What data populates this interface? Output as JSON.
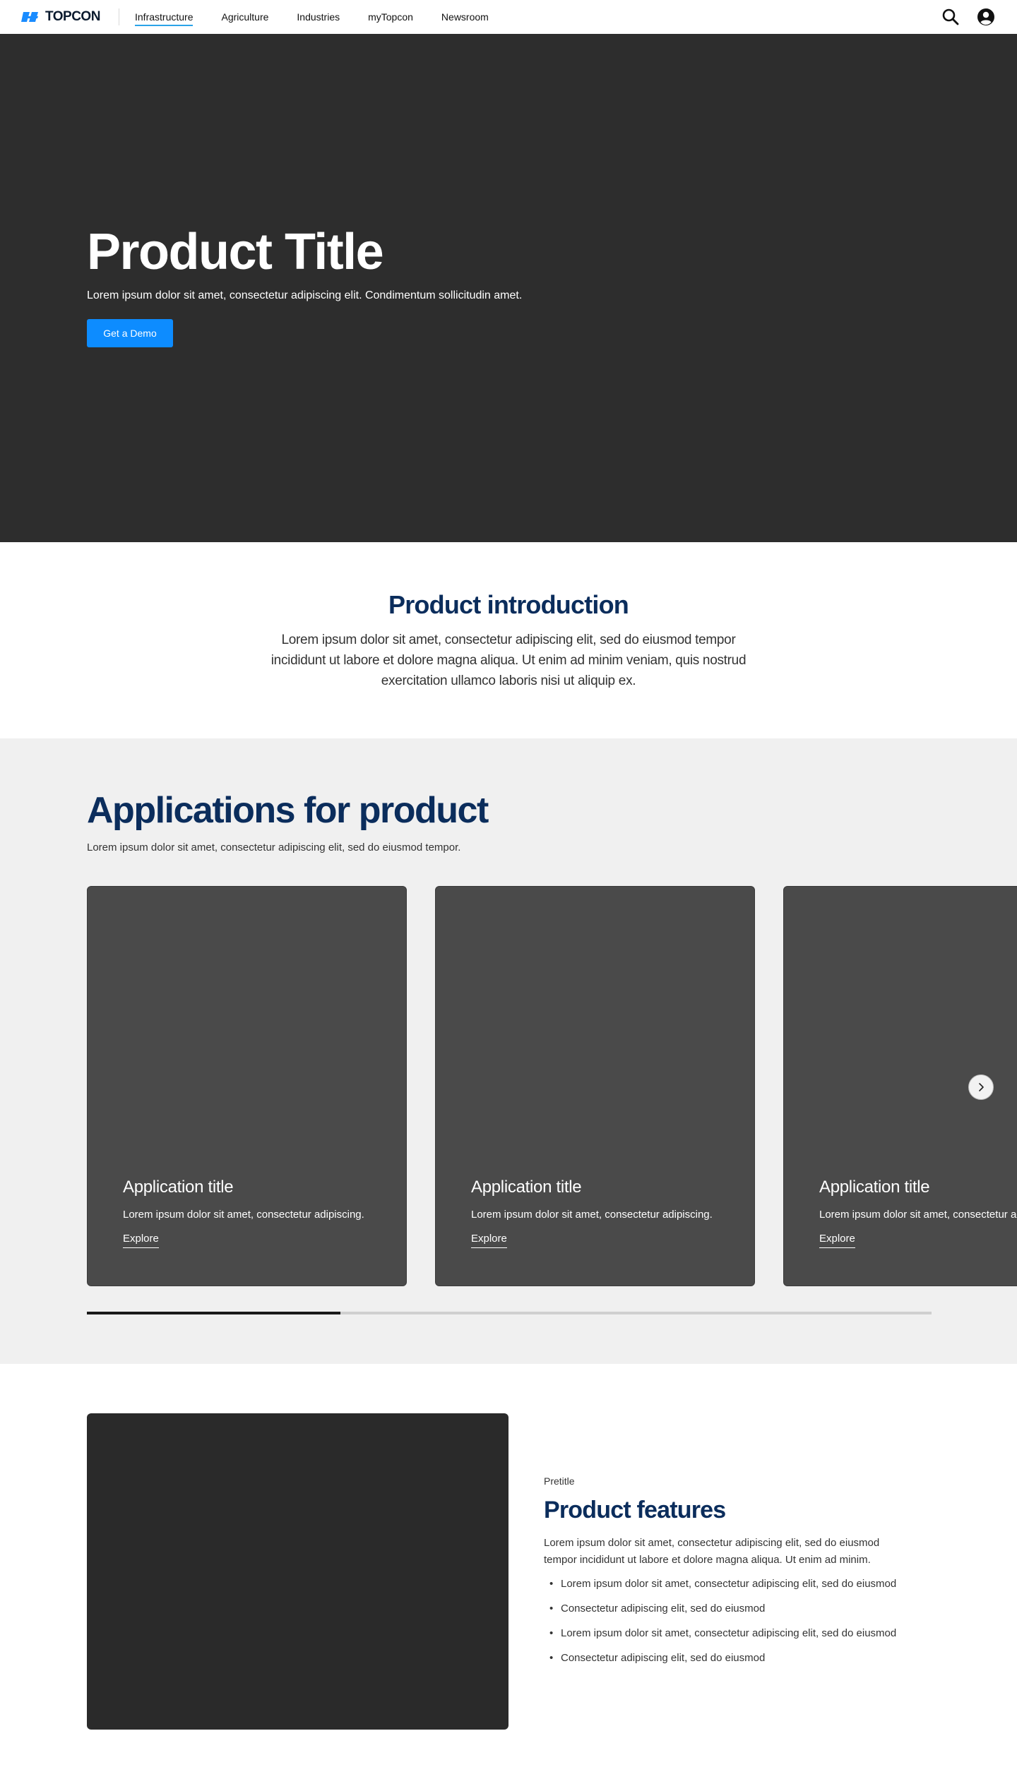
{
  "nav": {
    "logo_text": "TOPCON",
    "links": [
      {
        "label": "Infrastructure",
        "active": true
      },
      {
        "label": "Agriculture",
        "active": false
      },
      {
        "label": "Industries",
        "active": false
      },
      {
        "label": "myTopcon",
        "active": false
      },
      {
        "label": "Newsroom",
        "active": false
      }
    ],
    "icons": [
      "search-icon",
      "user-account-icon"
    ]
  },
  "hero": {
    "title": "Product Title",
    "subtitle": "Lorem ipsum dolor sit amet, consectetur adipiscing elit. Condimentum sollicitudin amet.",
    "cta_label": "Get a Demo"
  },
  "intro": {
    "title": "Product introduction",
    "body": "Lorem ipsum dolor sit amet, consectetur adipiscing elit, sed do eiusmod tempor incididunt ut labore et dolore magna aliqua. Ut enim ad minim veniam, quis nostrud exercitation ullamco laboris nisi ut aliquip ex."
  },
  "applications": {
    "title": "Applications for product",
    "subtitle": "Lorem ipsum dolor sit amet, consectetur adipiscing elit, sed do eiusmod tempor.",
    "cards": [
      {
        "title": "Application title",
        "text": "Lorem ipsum dolor sit amet, consectetur adipiscing.",
        "link": "Explore"
      },
      {
        "title": "Application title",
        "text": "Lorem ipsum dolor sit amet, consectetur adipiscing.",
        "link": "Explore"
      },
      {
        "title": "Application title",
        "text": "Lorem ipsum dolor sit amet, consectetur adipiscing.",
        "link": "Explore"
      }
    ],
    "carousel_progress": 0.3,
    "next_icon": "chevron-right-icon"
  },
  "features": {
    "pretitle": "Pretitle",
    "title": "Product features",
    "body": "Lorem ipsum dolor sit amet, consectetur adipiscing elit, sed do eiusmod tempor incididunt ut labore et dolore magna aliqua. Ut enim ad minim.",
    "bullets": [
      "Lorem ipsum dolor sit amet, consectetur adipiscing elit, sed do eiusmod",
      "Consectetur adipiscing elit, sed do eiusmod",
      "Lorem ipsum dolor sit amet, consectetur adipiscing elit, sed do eiusmod",
      "Consectetur adipiscing elit, sed do eiusmod"
    ]
  },
  "colors": {
    "brand_blue": "#0d8cff",
    "heading_navy": "#0b2d5c",
    "nav_active_underline": "#2aa3e8",
    "hero_bg": "#2d2d2d",
    "card_bg": "#4a4a4a",
    "section_gray": "#f0f0f0"
  }
}
